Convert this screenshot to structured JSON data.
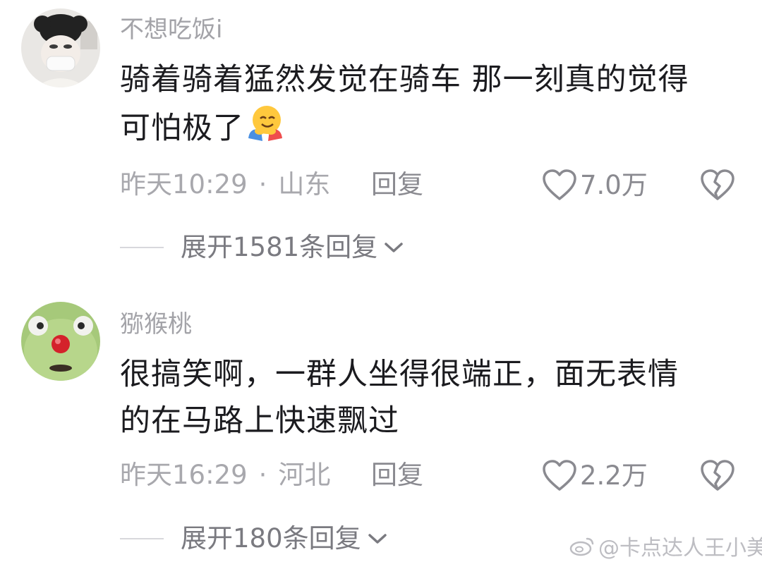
{
  "comments": [
    {
      "username": "不想吃饭i",
      "line1": "骑着骑着猛然发觉在骑车 那一刻真的觉得",
      "line2": "可怕极了",
      "emoji": "hugging-face-emoji",
      "time": "昨天10:29",
      "dot": "·",
      "location": "山东",
      "reply_label": "回复",
      "likes": "7.0万",
      "expand_label": "展开1581条回复"
    },
    {
      "username": "猕猴桃",
      "line1": "很搞笑啊，一群人坐得很端正，面无表情",
      "line2": "的在马路上快速飘过",
      "time": "昨天16:29",
      "dot": "·",
      "location": "河北",
      "reply_label": "回复",
      "likes": "2.2万",
      "expand_label": "展开180条回复"
    }
  ],
  "watermark": "@卡点达人王小美",
  "colors": {
    "text": "#1b1b1f",
    "muted": "#a3a3a8",
    "icon": "#8a8a90"
  }
}
